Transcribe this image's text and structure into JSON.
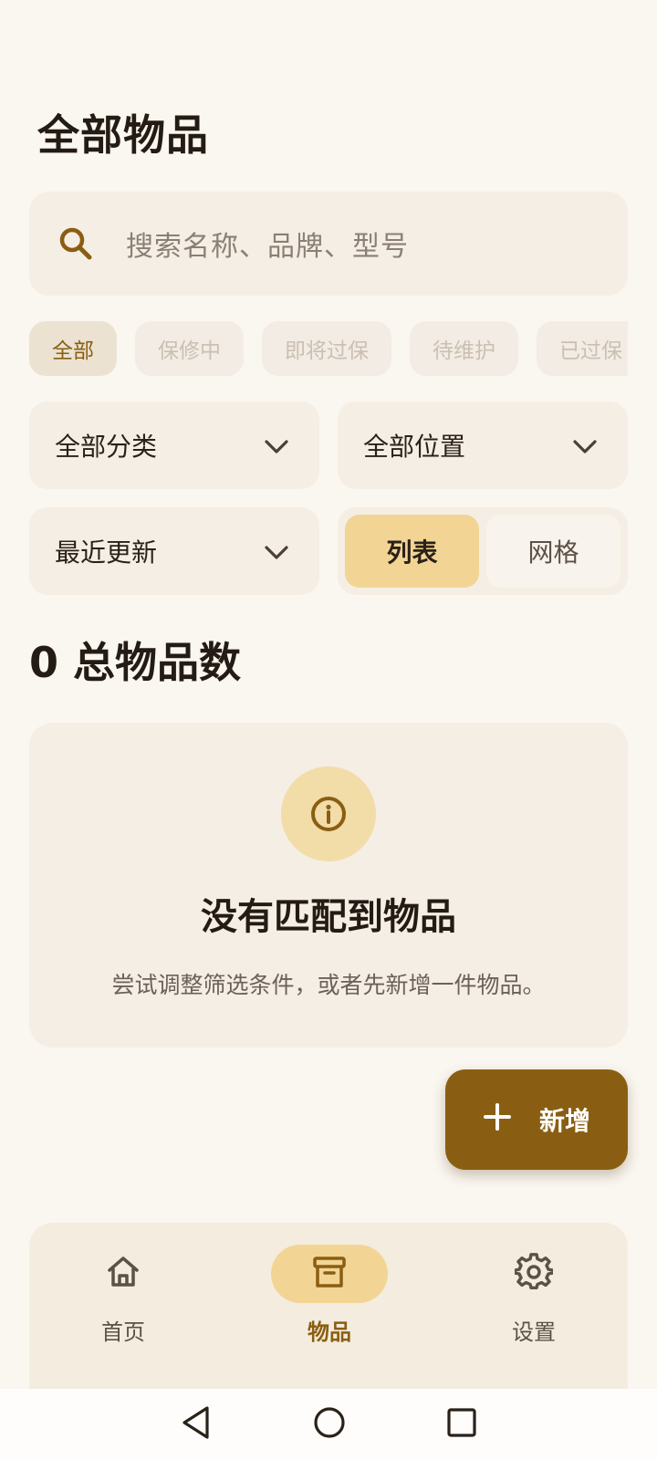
{
  "page": {
    "title": "全部物品"
  },
  "search": {
    "placeholder": "搜索名称、品牌、型号"
  },
  "chips": [
    {
      "label": "全部",
      "active": true
    },
    {
      "label": "保修中",
      "active": false
    },
    {
      "label": "即将过保",
      "active": false
    },
    {
      "label": "待维护",
      "active": false
    },
    {
      "label": "已过保",
      "active": false
    }
  ],
  "filters": {
    "category": "全部分类",
    "location": "全部位置",
    "sort": "最近更新"
  },
  "view_toggle": {
    "list": "列表",
    "grid": "网格",
    "selected": "list"
  },
  "summary": {
    "count": "0",
    "label": "总物品数"
  },
  "empty_state": {
    "title": "没有匹配到物品",
    "description": "尝试调整筛选条件，或者先新增一件物品。"
  },
  "fab": {
    "label": "新增"
  },
  "bottom_nav": {
    "items": [
      {
        "label": "首页",
        "icon": "home-icon",
        "active": false
      },
      {
        "label": "物品",
        "icon": "archive-box-icon",
        "active": true
      },
      {
        "label": "设置",
        "icon": "gear-icon",
        "active": false
      }
    ]
  },
  "colors": {
    "accent": "#8a5e12",
    "accent_soft": "#f2d595",
    "background": "#faf6f0",
    "surface": "#f5eee4"
  }
}
